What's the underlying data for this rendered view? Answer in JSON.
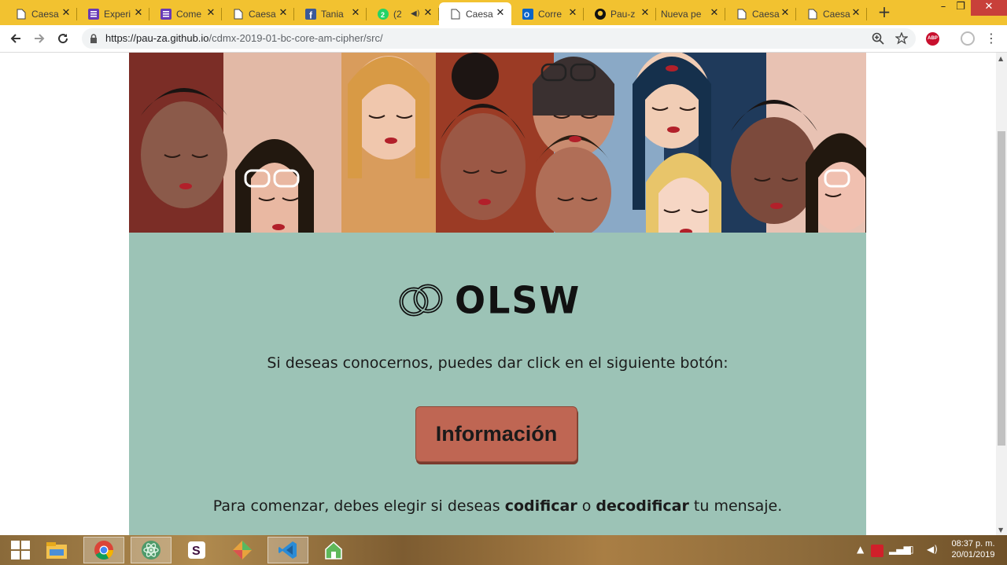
{
  "browser": {
    "tabs": [
      {
        "label": "Caesa",
        "icon": "document-icon"
      },
      {
        "label": "Experi",
        "icon": "form-icon"
      },
      {
        "label": "Come",
        "icon": "form-icon"
      },
      {
        "label": "Caesa",
        "icon": "document-icon"
      },
      {
        "label": "Tania",
        "icon": "facebook-icon"
      },
      {
        "label": "(2",
        "icon": "whatsapp-icon"
      },
      {
        "label": "Caesa",
        "icon": "document-icon",
        "active": true
      },
      {
        "label": "Corre",
        "icon": "outlook-icon"
      },
      {
        "label": "Pau-z",
        "icon": "github-icon"
      },
      {
        "label": "Nueva pe",
        "icon": "none"
      },
      {
        "label": "Caesa",
        "icon": "document-icon"
      },
      {
        "label": "Caesa",
        "icon": "document-icon"
      }
    ],
    "url_host": "https://pau-za.github.io",
    "url_path": "/cdmx-2019-01-bc-core-am-cipher/src/",
    "extension_badge": "ABP"
  },
  "page": {
    "logo_text": "OLSW",
    "intro_text": "Si deseas conocernos, puedes dar click en el siguiente botón:",
    "info_button_label": "Información",
    "start_prefix": "Para comenzar, debes elegir si deseas ",
    "start_encode": "codificar",
    "start_mid": " o ",
    "start_decode": "decodificar",
    "start_suffix": " tu mensaje.",
    "colors": {
      "panel": "#9cc3b6",
      "button": "#bf6653"
    }
  },
  "taskbar": {
    "time": "08:37 p. m.",
    "date": "20/01/2019",
    "apps": [
      "start-icon",
      "file-explorer-icon",
      "chrome-icon",
      "atom-icon",
      "slack-icon",
      "gitkraken-icon",
      "vscode-icon",
      "home-app-icon"
    ]
  }
}
